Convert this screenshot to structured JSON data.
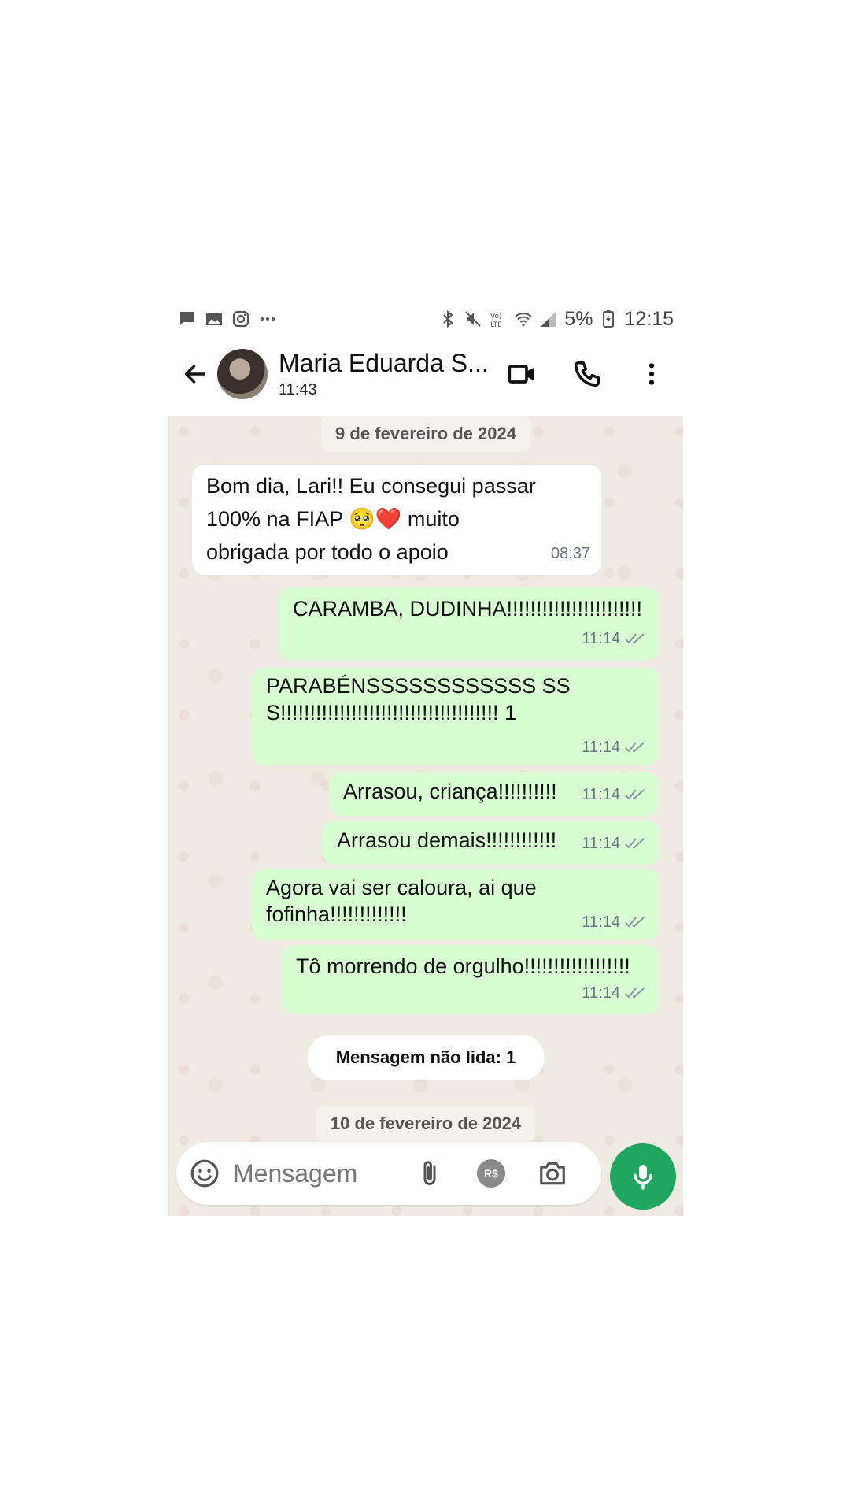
{
  "status_bar": {
    "notification_icons": [
      "message-icon",
      "image-icon",
      "instagram-icon",
      "more-dots-icon"
    ],
    "system_icons": [
      "bluetooth-icon",
      "mute-icon",
      "volte-icon",
      "wifi-icon",
      "signal-icon"
    ],
    "battery": "5%",
    "time": "12:15"
  },
  "header": {
    "contact_name": "Maria Eduarda S...",
    "last_seen": "11:43"
  },
  "chat": {
    "date_chip_1": "9 de fevereiro de 2024",
    "messages": [
      {
        "direction": "in",
        "text": "Bom dia, Lari!! Eu consegui passar 100% na FIAP 🥺❤️ muito obrigada por todo o apoio",
        "time": "08:37"
      },
      {
        "direction": "out",
        "text": "CARAMBA, DUDINHA!!!!!!!!!!!!!!!!!!!!!!!",
        "time": "11:14"
      },
      {
        "direction": "out",
        "text": "PARABÉNSSSSSSSSSSSS SSS!!!!!!!!!!!!!!!!!!!!!!!!!!!!!!!!!!!!! 1",
        "time": "11:14"
      },
      {
        "direction": "out",
        "text": "Arrasou, criança!!!!!!!!!!",
        "time": "11:14"
      },
      {
        "direction": "out",
        "text": "Arrasou demais!!!!!!!!!!!!",
        "time": "11:14"
      },
      {
        "direction": "out",
        "text": "Agora vai ser caloura, ai que fofinha!!!!!!!!!!!!!",
        "time": "11:14"
      },
      {
        "direction": "out",
        "text": "Tô morrendo de orgulho!!!!!!!!!!!!!!!!!!",
        "time": "11:14"
      }
    ],
    "unread_label": "Mensagem não lida: 1",
    "date_chip_2": "10 de fevereiro de 2024"
  },
  "input": {
    "placeholder": "Mensagem",
    "payment_label": "R$"
  },
  "colors": {
    "accent_green": "#21a660",
    "outgoing_bubble": "#d9fdd3",
    "chat_background": "#efeae2"
  }
}
